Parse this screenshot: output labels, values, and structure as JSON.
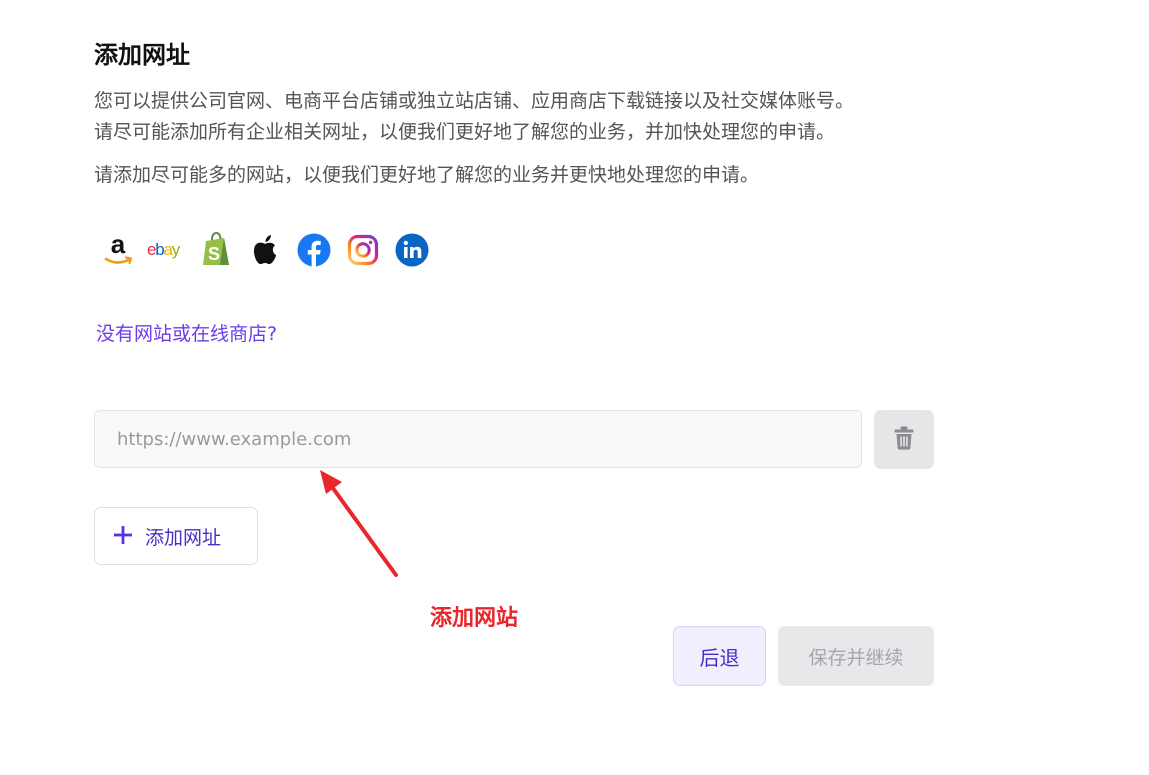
{
  "page": {
    "title": "添加网址",
    "description_line1": "您可以提供公司官网、电商平台店铺或独立站店铺、应用商店下载链接以及社交媒体账号。",
    "description_line2": "请尽可能添加所有企业相关网址，以便我们更好地了解您的业务，并加快处理您的申请。",
    "description_line3": "请添加尽可能多的网站，以便我们更好地了解您的业务并更快地处理您的申请。"
  },
  "brands": [
    {
      "icon": "amazon-icon"
    },
    {
      "icon": "ebay-icon",
      "text": "ebay"
    },
    {
      "icon": "shopify-icon"
    },
    {
      "icon": "apple-icon"
    },
    {
      "icon": "facebook-icon"
    },
    {
      "icon": "instagram-icon"
    },
    {
      "icon": "linkedin-icon"
    }
  ],
  "links": {
    "no_website": "没有网站或在线商店?"
  },
  "url_input": {
    "value": "",
    "placeholder": "https://www.example.com"
  },
  "buttons": {
    "add_url": "添加网址",
    "back": "后退",
    "save_continue": "保存并继续"
  },
  "annotation": {
    "text": "添加网站",
    "color": "#e8262c"
  },
  "colors": {
    "accent": "#5b32e0",
    "link": "#6a3de8"
  }
}
